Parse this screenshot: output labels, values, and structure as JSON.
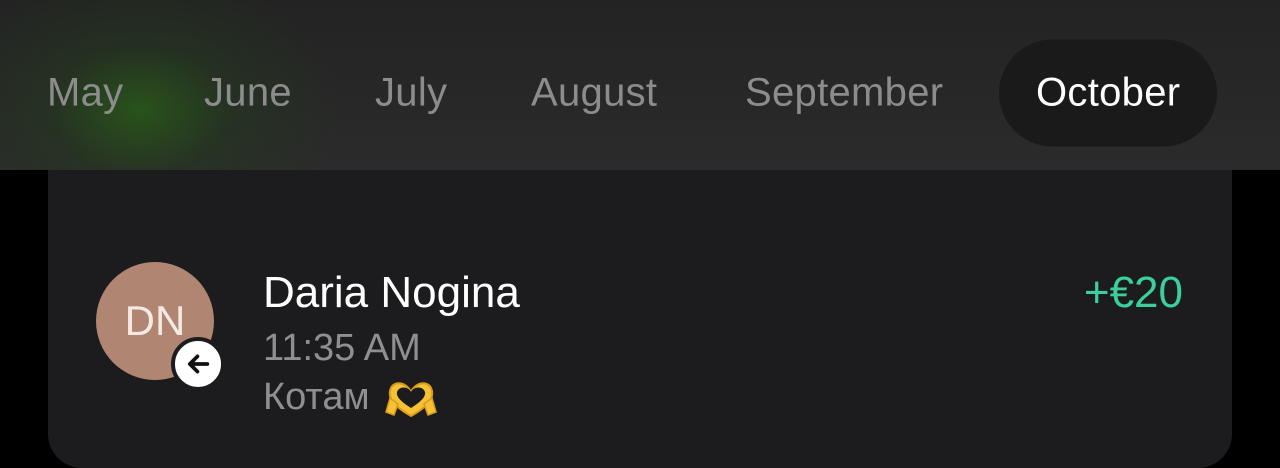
{
  "month_tabs": [
    {
      "label": "May"
    },
    {
      "label": "June"
    },
    {
      "label": "July"
    },
    {
      "label": "August"
    },
    {
      "label": "September"
    },
    {
      "label": "October",
      "selected": true
    }
  ],
  "transaction": {
    "avatar_initials": "DN",
    "direction_icon": "arrow-left-icon",
    "name": "Daria Nogina",
    "time": "11:35 AM",
    "note": "Котам",
    "note_emoji": "heart-hands-emoji",
    "amount": "+€20"
  },
  "colors": {
    "amount_positive": "#3ccf9b",
    "avatar_bg": "#b08572",
    "card_bg": "#1c1c1e",
    "tab_inactive": "#8c8c8c",
    "tab_active": "#ffffff"
  }
}
